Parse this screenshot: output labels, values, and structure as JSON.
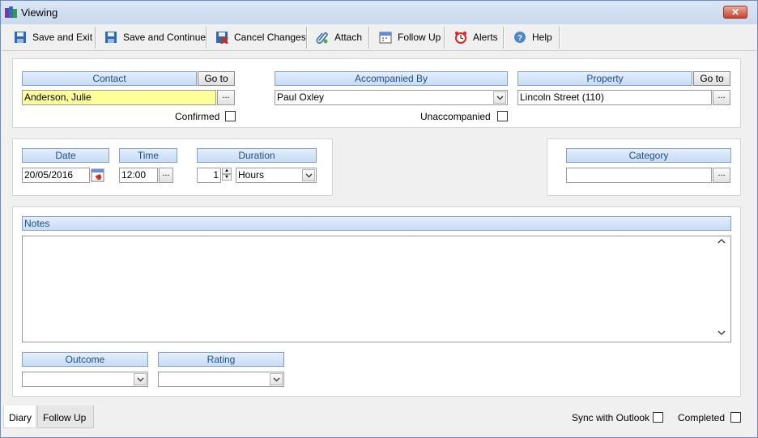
{
  "window": {
    "title": "Viewing",
    "close_label": "✕"
  },
  "toolbar": {
    "save_exit": "Save and Exit",
    "save_continue": "Save and Continue",
    "cancel": "Cancel Changes",
    "attach": "Attach",
    "follow_up": "Follow Up",
    "alerts": "Alerts",
    "help": "Help"
  },
  "contact": {
    "header": "Contact",
    "goto": "Go to",
    "value": "Anderson, Julie",
    "dots": "...",
    "confirmed_label": "Confirmed"
  },
  "accompanied": {
    "header": "Accompanied By",
    "value": "Paul Oxley",
    "unaccompanied_label": "Unaccompanied"
  },
  "property": {
    "header": "Property",
    "goto": "Go to",
    "value": "Lincoln Street (110)",
    "dots": "..."
  },
  "date": {
    "header": "Date",
    "value": "20/05/2016"
  },
  "time": {
    "header": "Time",
    "value": "12:00",
    "dots": "..."
  },
  "duration": {
    "header": "Duration",
    "amount": "1",
    "unit": "Hours"
  },
  "category": {
    "header": "Category",
    "value": "",
    "dots": "..."
  },
  "notes": {
    "header": "Notes",
    "value": ""
  },
  "outcome": {
    "header": "Outcome",
    "value": ""
  },
  "rating": {
    "header": "Rating",
    "value": ""
  },
  "tabs": {
    "diary": "Diary",
    "follow_up": "Follow Up"
  },
  "footer": {
    "sync_label": "Sync with Outlook",
    "completed_label": "Completed"
  }
}
